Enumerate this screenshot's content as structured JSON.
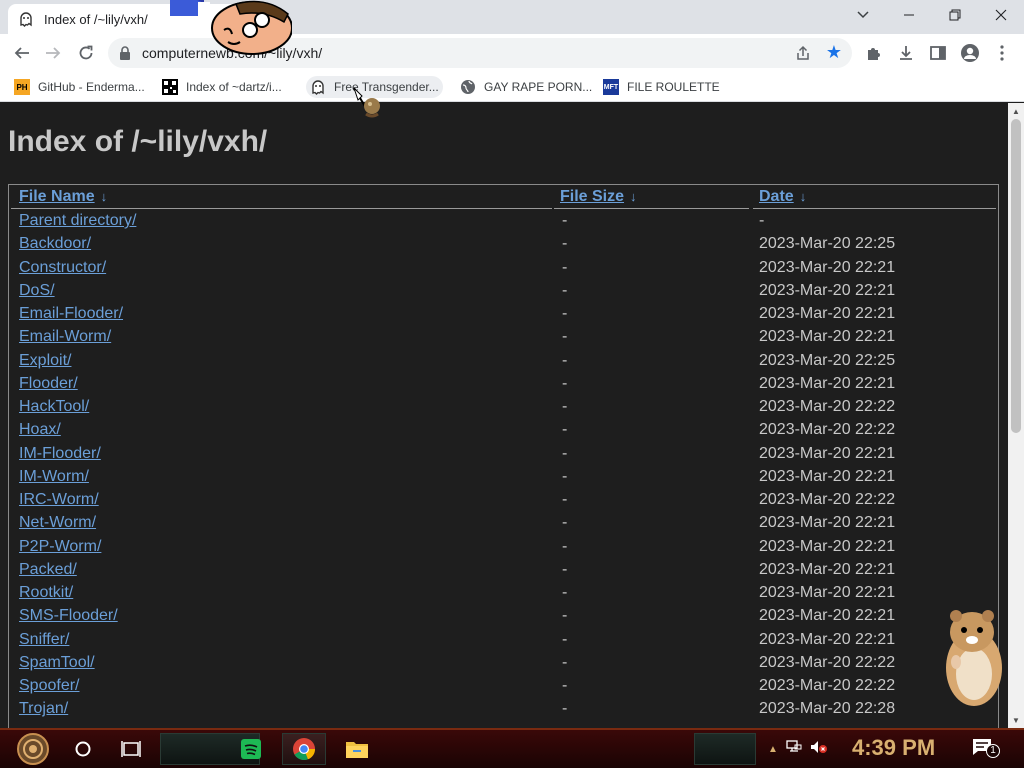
{
  "browser": {
    "tab_title": "Index of /~lily/vxh/",
    "url": "computernewb.com/~lily/vxh/"
  },
  "bookmarks": [
    {
      "label": "GitHub - Enderma...",
      "icon": "PH"
    },
    {
      "label": "Index of ~dartz/i...",
      "icon": "qr"
    },
    {
      "label": "Free Transgender...",
      "icon": "ghost"
    },
    {
      "label": "GAY RAPE PORN...",
      "icon": "globe"
    },
    {
      "label": "FILE ROULETTE",
      "icon": "MFT"
    }
  ],
  "page": {
    "title": "Index of /~lily/vxh/",
    "headers": {
      "name": "File Name",
      "size": "File Size",
      "date": "Date",
      "sort_arrow": "↓"
    },
    "rows": [
      {
        "name": "Parent directory/",
        "size": "-",
        "date": "-"
      },
      {
        "name": "Backdoor/",
        "size": "-",
        "date": "2023-Mar-20 22:25"
      },
      {
        "name": "Constructor/",
        "size": "-",
        "date": "2023-Mar-20 22:21"
      },
      {
        "name": "DoS/",
        "size": "-",
        "date": "2023-Mar-20 22:21"
      },
      {
        "name": "Email-Flooder/",
        "size": "-",
        "date": "2023-Mar-20 22:21"
      },
      {
        "name": "Email-Worm/",
        "size": "-",
        "date": "2023-Mar-20 22:21"
      },
      {
        "name": "Exploit/",
        "size": "-",
        "date": "2023-Mar-20 22:25"
      },
      {
        "name": "Flooder/",
        "size": "-",
        "date": "2023-Mar-20 22:21"
      },
      {
        "name": "HackTool/",
        "size": "-",
        "date": "2023-Mar-20 22:22"
      },
      {
        "name": "Hoax/",
        "size": "-",
        "date": "2023-Mar-20 22:22"
      },
      {
        "name": "IM-Flooder/",
        "size": "-",
        "date": "2023-Mar-20 22:21"
      },
      {
        "name": "IM-Worm/",
        "size": "-",
        "date": "2023-Mar-20 22:21"
      },
      {
        "name": "IRC-Worm/",
        "size": "-",
        "date": "2023-Mar-20 22:22"
      },
      {
        "name": "Net-Worm/",
        "size": "-",
        "date": "2023-Mar-20 22:21"
      },
      {
        "name": "P2P-Worm/",
        "size": "-",
        "date": "2023-Mar-20 22:21"
      },
      {
        "name": "Packed/",
        "size": "-",
        "date": "2023-Mar-20 22:21"
      },
      {
        "name": "Rootkit/",
        "size": "-",
        "date": "2023-Mar-20 22:21"
      },
      {
        "name": "SMS-Flooder/",
        "size": "-",
        "date": "2023-Mar-20 22:21"
      },
      {
        "name": "Sniffer/",
        "size": "-",
        "date": "2023-Mar-20 22:21"
      },
      {
        "name": "SpamTool/",
        "size": "-",
        "date": "2023-Mar-20 22:22"
      },
      {
        "name": "Spoofer/",
        "size": "-",
        "date": "2023-Mar-20 22:22"
      },
      {
        "name": "Trojan/",
        "size": "-",
        "date": "2023-Mar-20 22:28"
      }
    ]
  },
  "taskbar": {
    "clock": "4:39 PM",
    "notification_count": "1"
  },
  "colors": {
    "link": "#6b9fd8",
    "text": "#c8c8c8",
    "background": "#1e1e1e",
    "clock": "#d8b070"
  }
}
